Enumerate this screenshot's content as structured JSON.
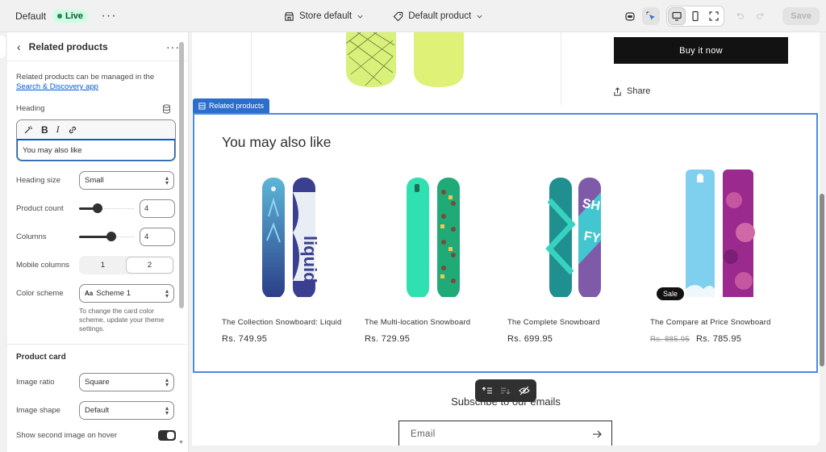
{
  "topbar": {
    "theme_name": "Default",
    "live_label": "Live",
    "store_select": "Store default",
    "product_select": "Default product",
    "save_label": "Save"
  },
  "panel": {
    "title": "Related products",
    "info_text": "Related products can be managed in the",
    "info_link": "Search & Discovery app",
    "heading_label": "Heading",
    "heading_value": "You may also like",
    "heading_size_label": "Heading size",
    "heading_size_value": "Small",
    "product_count_label": "Product count",
    "product_count_value": "4",
    "product_count_fraction": 0.3,
    "columns_label": "Columns",
    "columns_value": "4",
    "columns_fraction": 0.6,
    "mobile_columns_label": "Mobile columns",
    "mobile_columns_options": [
      "1",
      "2"
    ],
    "mobile_columns_selected": "2",
    "color_scheme_label": "Color scheme",
    "color_scheme_value": "Scheme 1",
    "color_scheme_swatch": "Aa",
    "color_scheme_help": "To change the card color scheme, update your theme settings.",
    "product_card_title": "Product card",
    "image_ratio_label": "Image ratio",
    "image_ratio_value": "Square",
    "image_shape_label": "Image shape",
    "image_shape_value": "Default",
    "second_image_label": "Show second image on hover",
    "second_image_on": true
  },
  "preview": {
    "buy_label": "Buy it now",
    "share_label": "Share",
    "section_tag": "Related products",
    "section_heading": "You may also like",
    "products": [
      {
        "title": "The Collection Snowboard: Liquid",
        "price": "Rs. 749.95",
        "compare_price": "",
        "sale": ""
      },
      {
        "title": "The Multi-location Snowboard",
        "price": "Rs. 729.95",
        "compare_price": "",
        "sale": ""
      },
      {
        "title": "The Complete Snowboard",
        "price": "Rs. 699.95",
        "compare_price": "",
        "sale": ""
      },
      {
        "title": "The Compare at Price Snowboard",
        "price": "Rs. 785.95",
        "compare_price": "Rs. 885.95",
        "sale": "Sale"
      }
    ],
    "subscribe_title": "Subscribe to our emails",
    "email_placeholder": "Email"
  },
  "colors": {
    "accent": "#2c6ecb",
    "live_bg": "#cdfee1",
    "button_dark": "#121212"
  }
}
